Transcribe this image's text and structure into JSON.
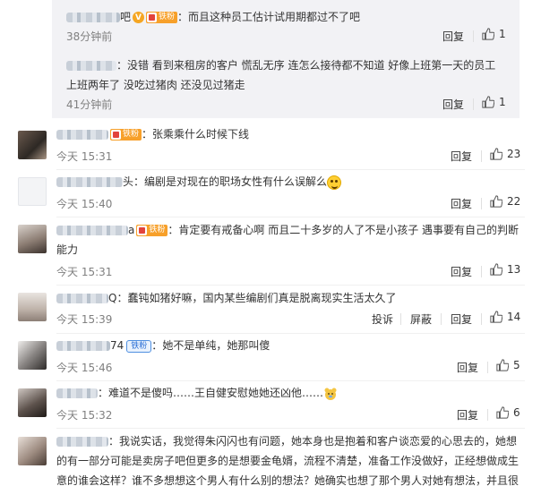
{
  "replies": [
    {
      "name_blur": "user-a",
      "suffix": "吧",
      "colon": "：",
      "badge_v": "V",
      "badge_label": "铁粉",
      "text": "而且这种员工估计试用期都过不了吧",
      "time": "38分钟前",
      "reply_label": "回复",
      "likes": "1"
    },
    {
      "name_blur": "user-b",
      "colon": "：",
      "text": "没错 看到来租房的客户 慌乱无序 连怎么接待都不知道 好像上班第一天的员工 上班两年了 没吃过猪肉 还没见过猪走",
      "time": "41分钟前",
      "reply_label": "回复",
      "likes": "1"
    }
  ],
  "comments": [
    {
      "id": "c1",
      "name_suffix": "",
      "badge_label": "铁粉",
      "text": "张乘乘什么时候下线",
      "time": "今天 15:31",
      "reply_label": "回复",
      "likes": "23"
    },
    {
      "id": "c2",
      "name_suffix": "头",
      "colon": "：",
      "text": "编剧是对现在的职场女性有什么误解么",
      "time": "今天 15:40",
      "reply_label": "回复",
      "likes": "22"
    },
    {
      "id": "c3",
      "name_suffix": "a",
      "badge_label": "铁粉",
      "colon": "：",
      "text": "肯定要有戒备心啊 而且二十多岁的人了不是小孩子 遇事要有自己的判断能力",
      "time": "今天 15:31",
      "reply_label": "回复",
      "likes": "13"
    },
    {
      "id": "c4",
      "name_suffix": "Q",
      "colon": "：",
      "text": "蠢钝如猪好嘛，国内某些编剧们真是脱离现实生活太久了",
      "time": "今天 15:39",
      "report_label": "投诉",
      "block_label": "屏蔽",
      "reply_label": "回复",
      "likes": "14"
    },
    {
      "id": "c5",
      "name_suffix": "74",
      "badge_label": "铁粉",
      "colon": "：",
      "text": "她不是单纯，她那叫傻",
      "time": "今天 15:46",
      "reply_label": "回复",
      "likes": "5"
    },
    {
      "id": "c6",
      "name_suffix": "",
      "colon": "：",
      "text": "难道不是傻吗……王自健安慰她她还凶他……",
      "time": "今天 15:32",
      "reply_label": "回复",
      "likes": "6"
    },
    {
      "id": "c7",
      "name_suffix": "",
      "colon": "：",
      "text": "我说实话，我觉得朱闪闪也有问题，她本身也是抱着和客户谈恋爱的心思去的，她想的有一部分可能是卖房子吧但更多的是想要金龟婿，流程不清楚，准备工作没做好，正经想做成生意的谁会这样？谁不多想想这个男人有什么别的想法？她确实也想了那个男人对她有想法，并且很"
    }
  ],
  "icons": {
    "like": "thumbs-up-icon",
    "emoji_grin": "grinning-emoji-icon",
    "emoji_bear": "bear-emoji-icon"
  },
  "colors": {
    "badge_orange": "#f7a02a",
    "reply_bg": "#f2f2f5",
    "time_gray": "#808080"
  }
}
